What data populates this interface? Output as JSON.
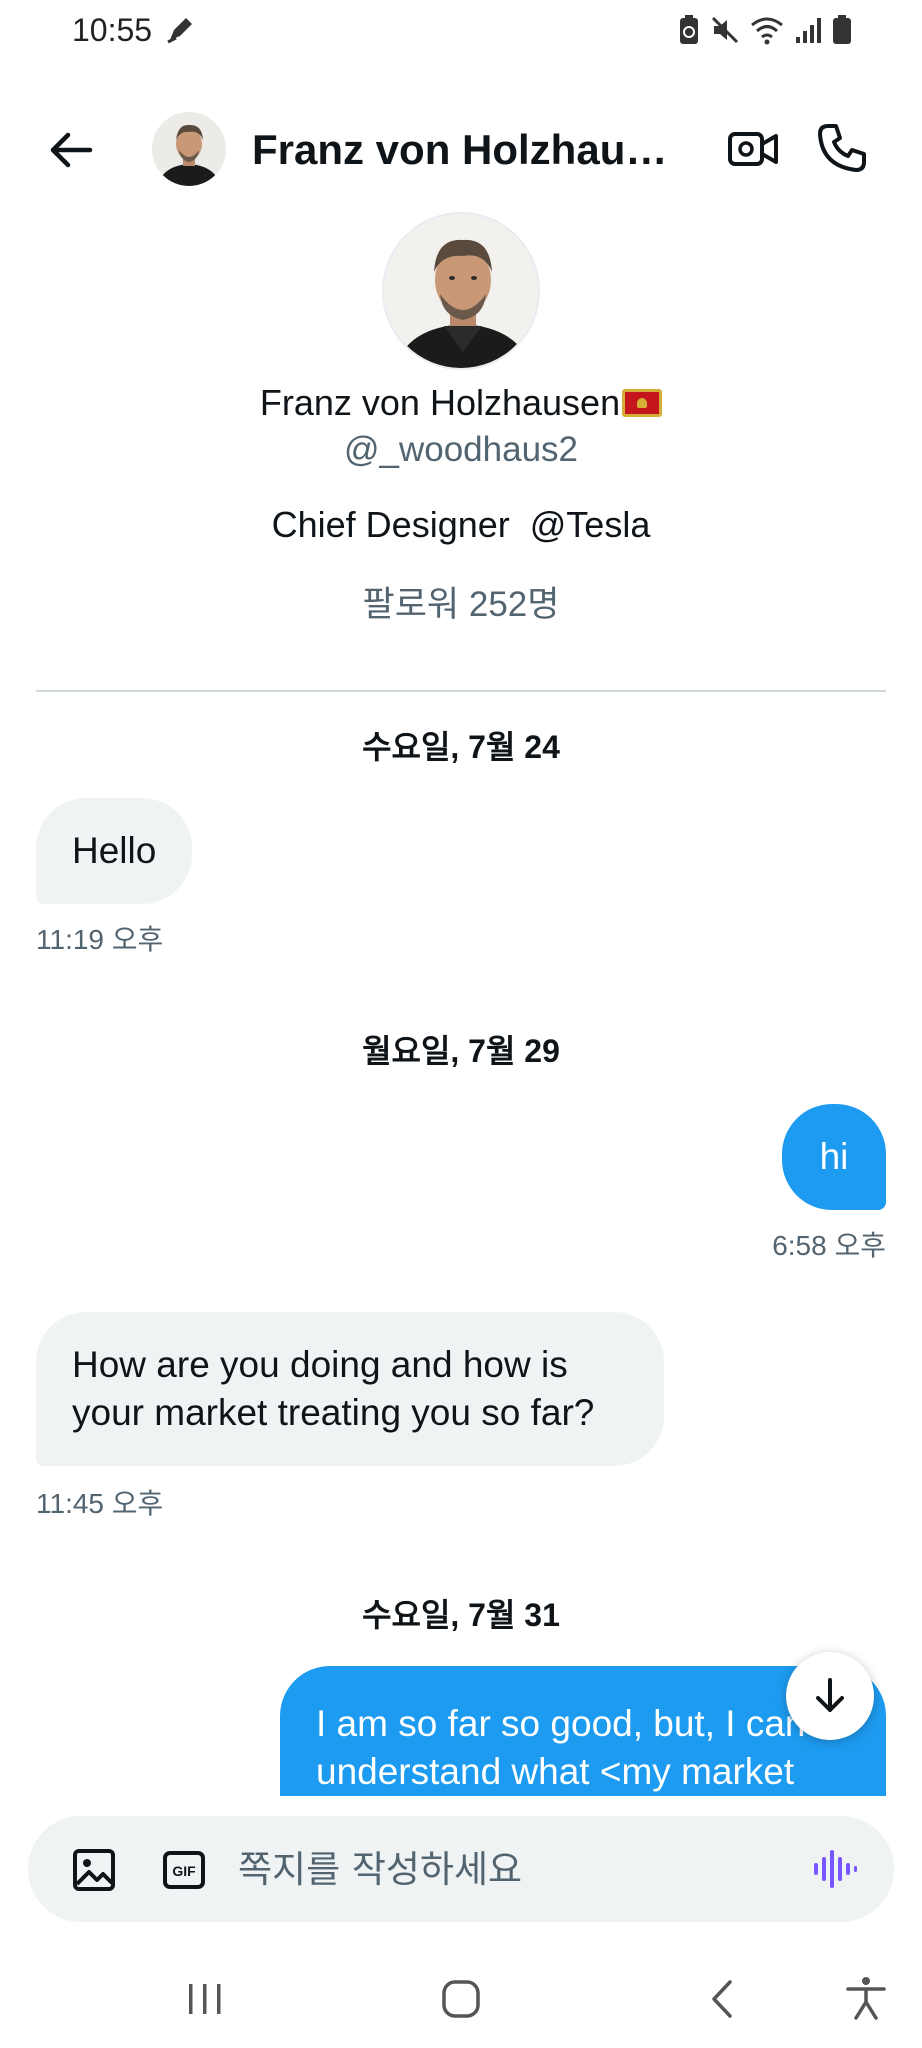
{
  "status_bar": {
    "time": "10:55",
    "icons": [
      "pen-icon",
      "battery-saver-icon",
      "mute-icon",
      "wifi-icon",
      "signal-icon",
      "battery-icon"
    ]
  },
  "header": {
    "name": "Franz von Holzhaus..."
  },
  "profile": {
    "name": "Franz von Holzhausen",
    "handle": "@_woodhaus2",
    "bio": "Chief Designer  @Tesla",
    "followers": "팔로워 252명"
  },
  "messages": [
    {
      "date": "수요일, 7월 24",
      "text": "Hello",
      "time": "11:19 오후",
      "direction": "in"
    },
    {
      "date": "월요일, 7월 29",
      "text": "hi",
      "time": "6:58 오후",
      "direction": "out"
    },
    {
      "text_lines": [
        "How are you doing and how is",
        "your market treating you so far?"
      ],
      "time": "11:45 오후",
      "direction": "in"
    },
    {
      "date": "수요일, 7월 31",
      "text_lines": [
        "I am so far so good, but, I can",
        "understand what <my market"
      ],
      "direction": "out"
    }
  ],
  "composer": {
    "placeholder": "쪽지를 작성하세요",
    "gif_label": "GIF"
  },
  "colors": {
    "accent": "#1d9bf0",
    "incoming_bubble": "#eff3f4",
    "secondary_text": "#536471",
    "voice_icon": "#7856ff"
  }
}
